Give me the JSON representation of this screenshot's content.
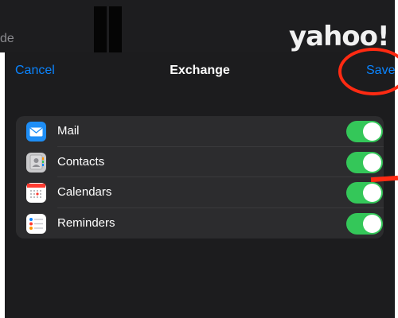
{
  "background": {
    "fragment_text": "de",
    "logo_text": "yahoo!"
  },
  "nav": {
    "cancel": "Cancel",
    "title": "Exchange",
    "save": "Save"
  },
  "accounts": [
    {
      "label": "Mail",
      "icon": "mail-icon",
      "enabled": true
    },
    {
      "label": "Contacts",
      "icon": "contacts-icon",
      "enabled": true
    },
    {
      "label": "Calendars",
      "icon": "calendar-icon",
      "enabled": true
    },
    {
      "label": "Reminders",
      "icon": "reminders-icon",
      "enabled": true
    }
  ],
  "colors": {
    "accent": "#0a84ff",
    "toggle_on": "#34c759",
    "annotation": "#ff2a12"
  }
}
